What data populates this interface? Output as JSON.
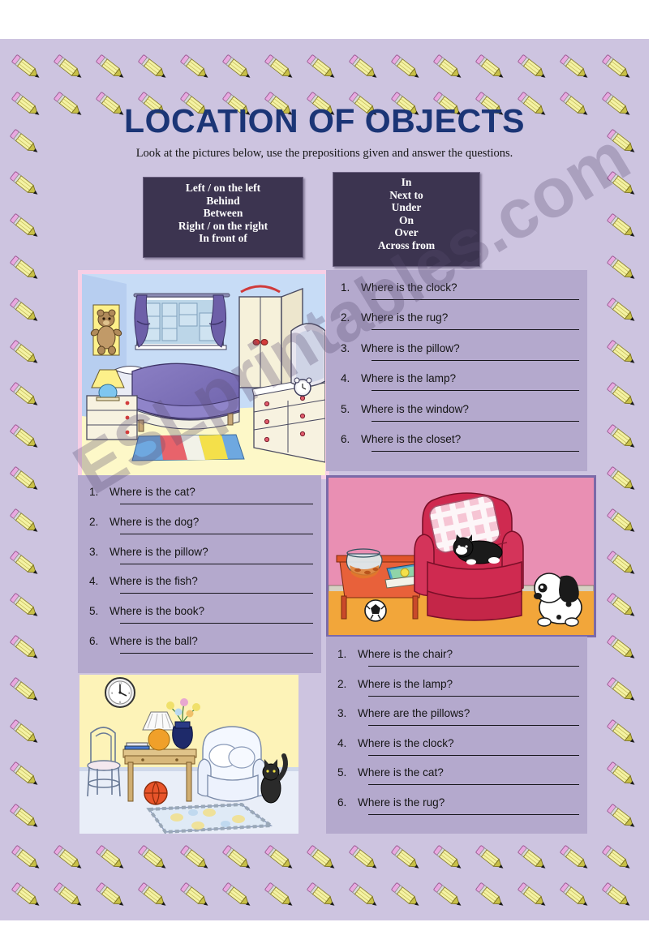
{
  "header": {
    "title": "LOCATION OF OBJECTS",
    "subtitle": "Look at the pictures below, use the prepositions given and answer the questions.",
    "title_color": "#1b3576"
  },
  "preposition_boxes": [
    {
      "name": "left-box",
      "background": "#3c3450",
      "items": [
        "Left / on the left",
        "Behind",
        "Between",
        "Right / on the right",
        "In front of"
      ]
    },
    {
      "name": "right-box",
      "background": "#3c3450",
      "items": [
        "In",
        "Next to",
        "Under",
        "On",
        "Over",
        "Across from"
      ]
    }
  ],
  "question_blocks": [
    {
      "name": "bedroom-questions",
      "background": "#b4a9cd",
      "items": [
        {
          "num": "1.",
          "text": "Where is the clock?"
        },
        {
          "num": "2.",
          "text": "Where is the rug?"
        },
        {
          "num": "3.",
          "text": "Where is the pillow?"
        },
        {
          "num": "4.",
          "text": "Where is the lamp?"
        },
        {
          "num": "5.",
          "text": "Where is the window?"
        },
        {
          "num": "6.",
          "text": "Where is the closet?"
        }
      ]
    },
    {
      "name": "livingroom-questions",
      "background": "#b4a9cd",
      "items": [
        {
          "num": "1.",
          "text": "Where is the cat?"
        },
        {
          "num": "2.",
          "text": "Where is the dog?"
        },
        {
          "num": "3.",
          "text": "Where is the pillow?"
        },
        {
          "num": "4.",
          "text": "Where is the fish?"
        },
        {
          "num": "5.",
          "text": "Where is the book?"
        },
        {
          "num": "6.",
          "text": "Where is the ball?"
        }
      ]
    },
    {
      "name": "sittingroom-questions",
      "background": "#b4a9cd",
      "items": [
        {
          "num": "1.",
          "text": "Where is the chair?"
        },
        {
          "num": "2.",
          "text": "Where is the lamp?"
        },
        {
          "num": "3.",
          "text": "Where are the pillows?"
        },
        {
          "num": "4.",
          "text": "Where is the clock?"
        },
        {
          "num": "5.",
          "text": "Where is the cat?"
        },
        {
          "num": "6.",
          "text": "Where is the rug?"
        }
      ]
    }
  ],
  "pictures": [
    {
      "name": "bedroom-illustration",
      "frame_color": "#f7cfe6",
      "objects": [
        "teddy bear poster",
        "window",
        "purple curtains",
        "closet",
        "bed",
        "pillow",
        "nightstand",
        "lamp",
        "dresser",
        "mirror",
        "alarm clock",
        "striped rug"
      ]
    },
    {
      "name": "livingroom-illustration",
      "frame_color": "#7b6aa8",
      "objects": [
        "pink wall",
        "red armchair",
        "checkered pillow",
        "black cat",
        "orange table",
        "fishbowl",
        "book",
        "soccer ball",
        "dalmatian dog"
      ]
    },
    {
      "name": "sittingroom-illustration",
      "frame_color": "#fdf6c9",
      "objects": [
        "wall clock",
        "wire chair",
        "wooden table",
        "lamp",
        "flower vase",
        "books",
        "basketball",
        "white armchair",
        "pillows",
        "black cat",
        "patterned rug"
      ]
    }
  ],
  "watermark": {
    "text": "ESLprintables.com"
  },
  "page": {
    "background": "#cdc4e0"
  },
  "border": {
    "icon": "pencil-icon",
    "body_color": "#f2f0a0",
    "eraser_color": "#e8a8e0",
    "tip_color": "#1a1a1a"
  }
}
